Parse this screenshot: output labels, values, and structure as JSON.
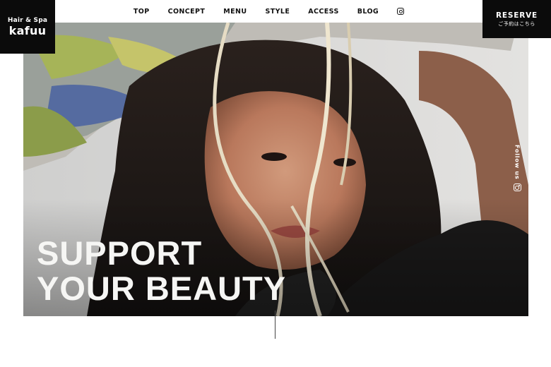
{
  "brand": {
    "sub": "Hair & Spa",
    "name": "kafuu"
  },
  "nav": {
    "items": [
      {
        "label": "TOP"
      },
      {
        "label": "CONCEPT"
      },
      {
        "label": "MENU"
      },
      {
        "label": "STYLE"
      },
      {
        "label": "ACCESS"
      },
      {
        "label": "BLOG"
      }
    ],
    "instagram_icon": "instagram-icon"
  },
  "reserve": {
    "label": "RESERVE",
    "sub": "ご予約はこちら"
  },
  "hero": {
    "headline_line1": "SUPPORT",
    "headline_line2": "YOUR BEAUTY"
  },
  "follow": {
    "label": "Follow us",
    "icon": "instagram-icon"
  },
  "colors": {
    "black": "#0b0b0b",
    "white": "#ffffff",
    "headline": "#f6f6f4"
  }
}
